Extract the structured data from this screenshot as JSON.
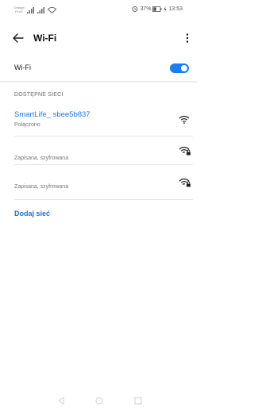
{
  "status_bar": {
    "carrier_line1": "Orange",
    "carrier_line2": "PLAY",
    "alarm_icon": "alarm-clock-icon",
    "battery_percent": "37%",
    "battery_icon": "battery-icon",
    "charging_icon": "charging-bolt-icon",
    "time": "13:53"
  },
  "app_bar": {
    "title": "Wi-Fi",
    "back_icon": "arrow-left-icon",
    "more_icon": "more-vertical-icon"
  },
  "wifi_toggle": {
    "label": "Wi-Fi",
    "enabled": true,
    "accent_color": "#1a7df1"
  },
  "available_networks": {
    "header": "DOSTĘPNE SIECI",
    "networks": [
      {
        "name": "SmartLife_ sbee5b837",
        "status": "Połączono",
        "connected": true,
        "secured": false,
        "icon": "wifi-signal-icon"
      },
      {
        "name": "",
        "status": "Zapisana, szyfrowana",
        "connected": false,
        "secured": true,
        "icon": "wifi-locked-icon"
      },
      {
        "name": "",
        "status": "Zapisana, szyfrowana",
        "connected": false,
        "secured": true,
        "icon": "wifi-locked-icon"
      }
    ]
  },
  "add_network": {
    "label": "Dodaj sieć"
  },
  "nav_bar": {
    "back_icon": "nav-back-triangle-icon",
    "home_icon": "nav-home-circle-icon",
    "recents_icon": "nav-recents-square-icon"
  }
}
